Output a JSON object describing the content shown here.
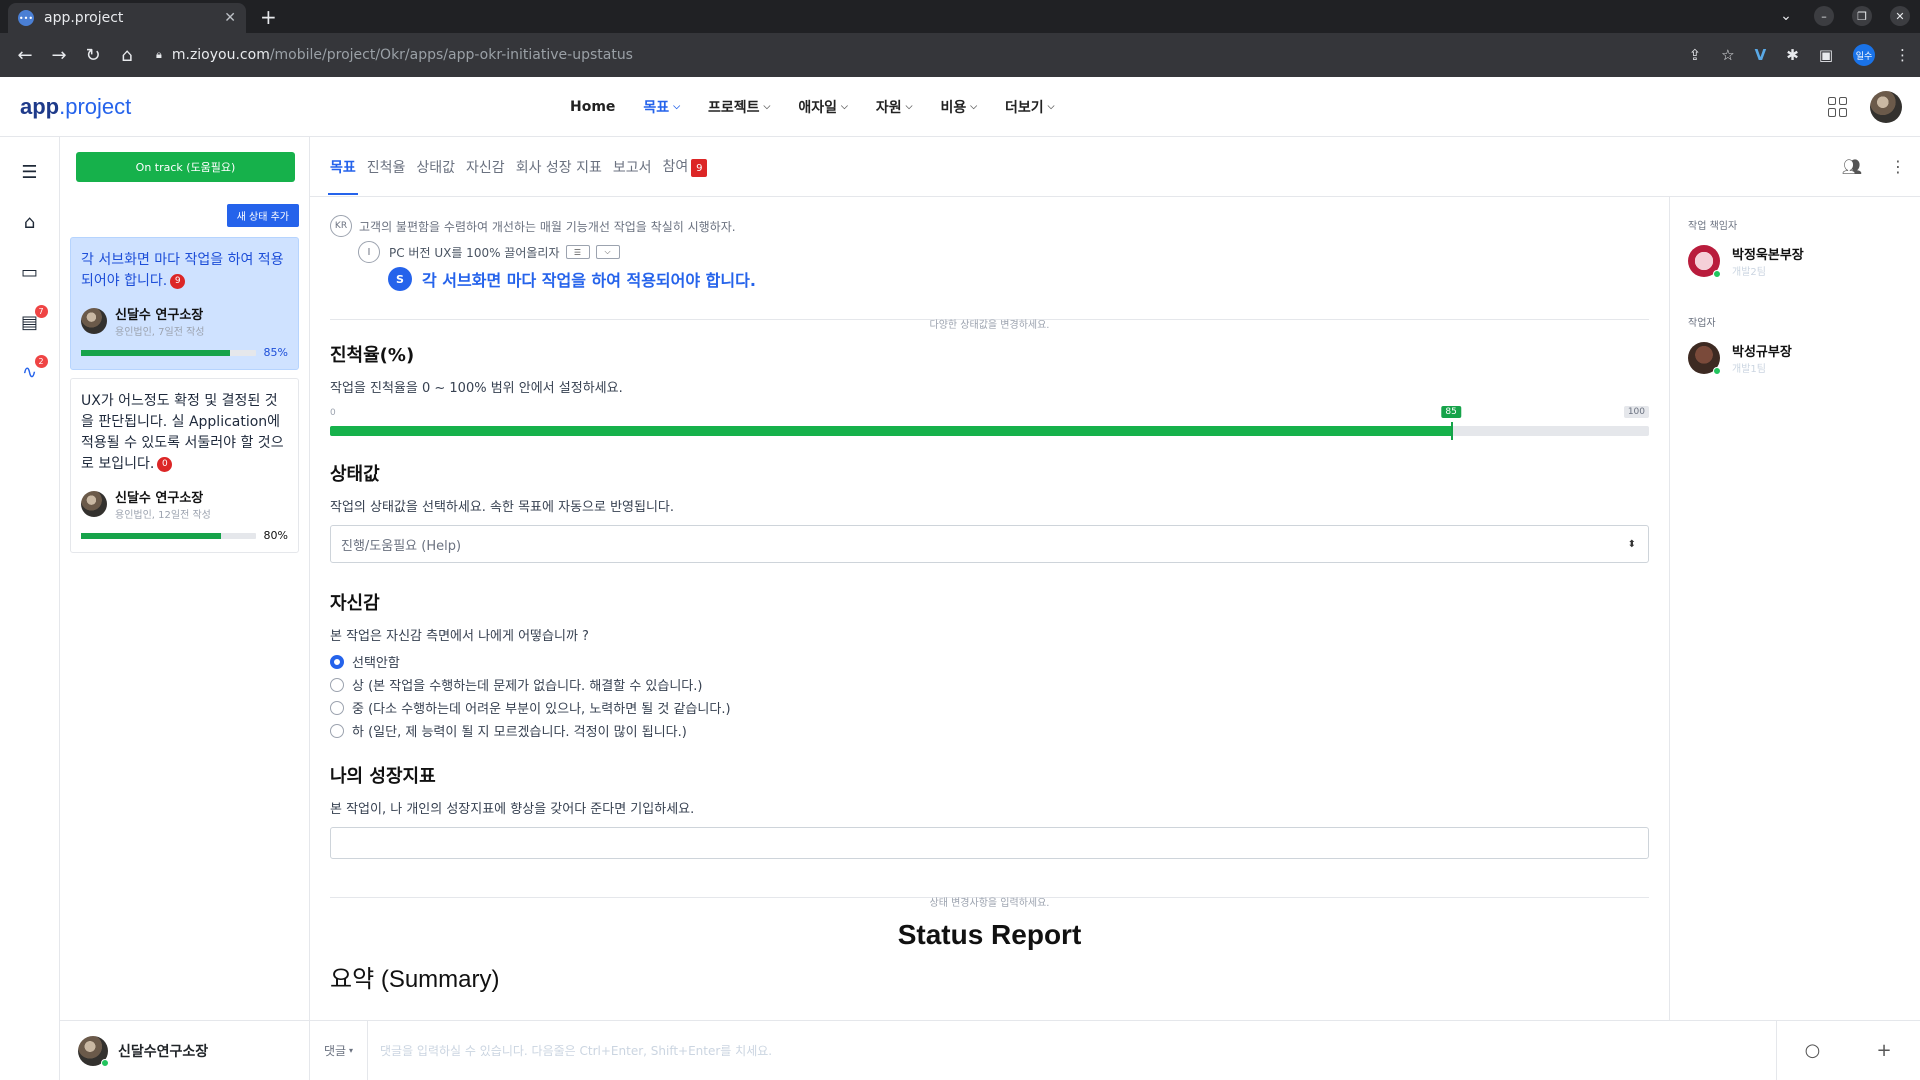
{
  "browser": {
    "tab_title": "app.project",
    "url_host": "m.zioyou.com",
    "url_path": "/mobile/project/Okr/apps/app-okr-initiative-upstatus",
    "profile_label": "일수"
  },
  "header": {
    "logo_bold": "app",
    "logo_light": ".project",
    "nav": [
      {
        "label": "Home"
      },
      {
        "label": "목표"
      },
      {
        "label": "프로젝트"
      },
      {
        "label": "애자일"
      },
      {
        "label": "자원"
      },
      {
        "label": "비용"
      },
      {
        "label": "더보기"
      }
    ]
  },
  "rail": {
    "badge_1": "7",
    "badge_2": "2"
  },
  "left": {
    "status_button": "On track (도움필요)",
    "add_status": "새 상태 추가",
    "cards": [
      {
        "title": "각 서브화면 마다 작업을 하여 적용되어야 합니다.",
        "badge": "9",
        "author": "신달수 연구소장",
        "meta": "용인법인, 7일전 작성",
        "progress": 0.85,
        "pct_label": "85%"
      },
      {
        "title": "UX가 어느정도 확정 및 결정된 것을 판단됩니다. 실 Application에 적용될 수 있도록 서둘러야 할 것으로 보입니다.",
        "badge": "0",
        "author": "신달수 연구소장",
        "meta": "용인법인, 12일전 작성",
        "progress": 0.8,
        "pct_label": "80%"
      }
    ],
    "footer_user": "신달수연구소장"
  },
  "tabs": [
    {
      "label": "목표"
    },
    {
      "label": "진척율"
    },
    {
      "label": "상태값"
    },
    {
      "label": "자신감"
    },
    {
      "label": "회사 성장 지표"
    },
    {
      "label": "보고서"
    },
    {
      "label": "참여",
      "badge": "9"
    }
  ],
  "main": {
    "kr_chip": "KR",
    "kr_text": "고객의 불편함을 수렴하여 개선하는 매월 기능개선 작업을 착실히 시행하자.",
    "init_chip": "I",
    "init_text": "PC 버전 UX를 100% 끌어올리자",
    "task_chip": "S",
    "task_text": "각 서브화면 마다 작업을 하여 적용되어야 합니다.",
    "divider1": "다양한 상태값을 변경하세요.",
    "progress_title": "진척율(%)",
    "progress_desc": "작업을 진척율을 0 ~ 100% 범위 안에서 설정하세요.",
    "slider_min": "0",
    "slider_max": "100",
    "slider_value_label": "85",
    "slider_value": 85,
    "status_title": "상태값",
    "status_desc": "작업의 상태값을 선택하세요. 속한 목표에 자동으로 반영됩니다.",
    "status_selected": "진행/도움필요 (Help)",
    "confidence_title": "자신감",
    "confidence_desc": "본 작업은 자신감 측면에서 나에게 어떻습니까 ?",
    "confidence_options": [
      {
        "label": "선택안함",
        "checked": true
      },
      {
        "label": "상 (본 작업을 수행하는데 문제가 없습니다. 해결할 수 있습니다.)",
        "checked": false
      },
      {
        "label": "중 (다소 수행하는데 어려운 부분이 있으나, 노력하면 될 것 같습니다.)",
        "checked": false
      },
      {
        "label": "하 (일단, 제 능력이 될 지 모르겠습니다. 걱정이 많이 됩니다.)",
        "checked": false
      }
    ],
    "growth_title": "나의 성장지표",
    "growth_desc": "본 작업이, 나 개인의 성장지표에 향상을 갖어다 준다면 기입하세요.",
    "growth_value": "",
    "divider2": "상태 변경사항을 입력하세요.",
    "report_title": "Status Report",
    "summary_title": "요약 (Summary)"
  },
  "right": {
    "owner_label": "작업 책임자",
    "owner_name": "박정욱본부장",
    "owner_dept": "개발2팀",
    "worker_label": "작업자",
    "worker_name": "박성규부장",
    "worker_dept": "개발1팀"
  },
  "comment": {
    "type": "댓글",
    "placeholder": "댓글을 입력하실 수 있습니다. 다음줄은 Ctrl+Enter, Shift+Enter를 치세요."
  },
  "colors": {
    "accent": "#2563eb",
    "success": "#16b14b",
    "danger": "#dc2626"
  }
}
